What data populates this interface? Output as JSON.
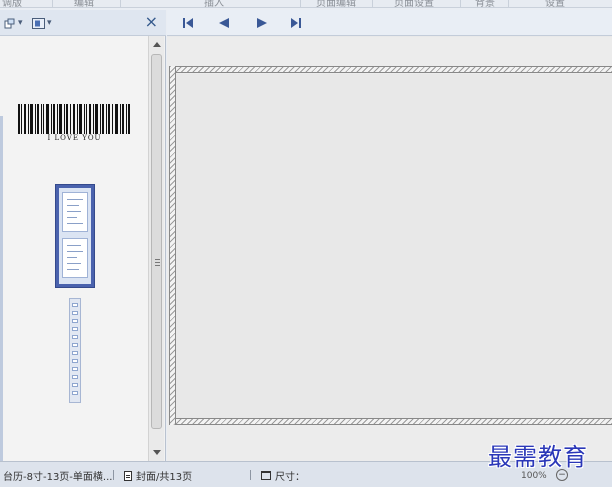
{
  "ribbon": {
    "groups": [
      "调版",
      "编辑",
      "插入",
      "页面编辑",
      "页面设置",
      "背景",
      "设置"
    ]
  },
  "left_panel": {
    "toolbar": {
      "view_icon": "page-layout-icon",
      "thumb_icon": "thumbnail-view-icon",
      "close_glyph": "×"
    },
    "barcode_text": "I LOVE YOU"
  },
  "nav": {
    "first": "first-page-icon",
    "prev": "prev-page-icon",
    "next": "next-page-icon",
    "last": "last-page-icon"
  },
  "status": {
    "template": "台历-8寸-13页-单面横...",
    "page": "封面/共13页",
    "size": "尺寸："
  },
  "zoom": {
    "value": "100%"
  },
  "watermark": "最需教育",
  "colors": {
    "accent": "#2a37b8",
    "nav_icon": "#3a5896"
  }
}
